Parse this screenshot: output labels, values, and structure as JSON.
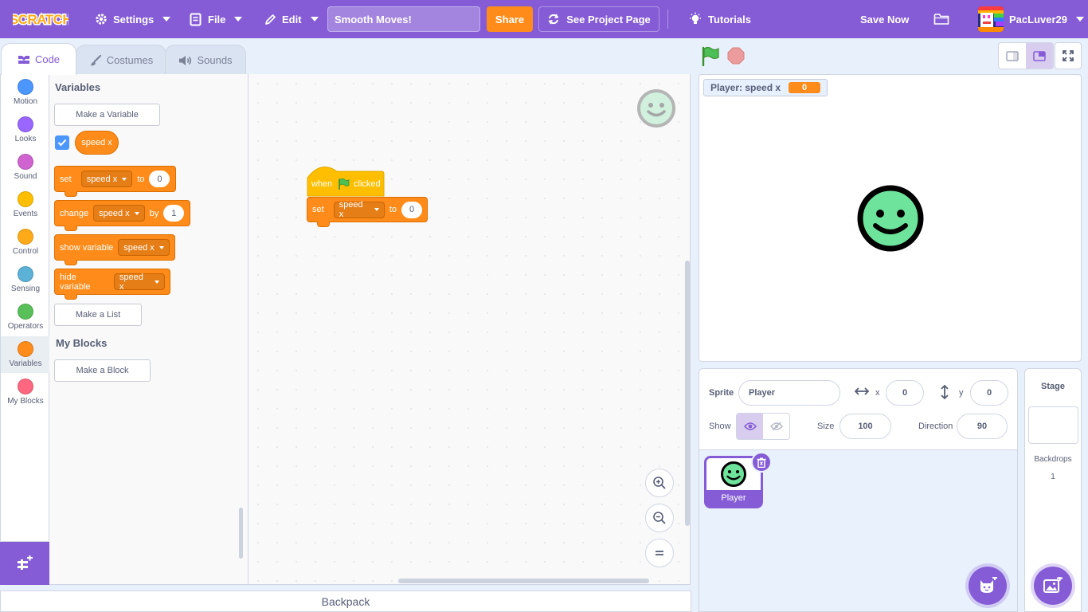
{
  "menubar": {
    "logo_text": "SCRATCH",
    "settings": "Settings",
    "file": "File",
    "edit": "Edit",
    "project_title": "Smooth Moves!",
    "share": "Share",
    "see_project_page": "See Project Page",
    "tutorials": "Tutorials",
    "save_now": "Save Now",
    "username": "PacLuver29",
    "bg_color": "#855cd6"
  },
  "tabs": [
    {
      "label": "Code",
      "active": true
    },
    {
      "label": "Costumes",
      "active": false
    },
    {
      "label": "Sounds",
      "active": false
    }
  ],
  "categories": [
    {
      "label": "Motion",
      "color": "#4c97ff"
    },
    {
      "label": "Looks",
      "color": "#9966ff"
    },
    {
      "label": "Sound",
      "color": "#cf63cf"
    },
    {
      "label": "Events",
      "color": "#ffbf00"
    },
    {
      "label": "Control",
      "color": "#ffab19"
    },
    {
      "label": "Sensing",
      "color": "#5cb1d6"
    },
    {
      "label": "Operators",
      "color": "#59c059"
    },
    {
      "label": "Variables",
      "color": "#ff8c1a"
    },
    {
      "label": "My Blocks",
      "color": "#ff6680"
    }
  ],
  "palette": {
    "variables_heading": "Variables",
    "make_variable": "Make a Variable",
    "variable_name": "speed x",
    "variable_checked": true,
    "set_block": {
      "word": "set",
      "var": "speed x",
      "to": "to",
      "value": "0"
    },
    "change_block": {
      "word": "change",
      "var": "speed x",
      "by": "by",
      "value": "1"
    },
    "show_block": {
      "word": "show variable",
      "var": "speed x"
    },
    "hide_block": {
      "word": "hide variable",
      "var": "speed x"
    },
    "make_list": "Make a List",
    "myblocks_heading": "My Blocks",
    "make_block": "Make a Block"
  },
  "script": {
    "hat_when": "when",
    "hat_clicked": "clicked",
    "set_word": "set",
    "set_var": "speed x",
    "set_to": "to",
    "set_value": "0"
  },
  "backpack": "Backpack",
  "stage": {
    "monitor_label": "Player: speed x",
    "monitor_value": "0"
  },
  "sprite_info": {
    "sprite_label": "Sprite",
    "sprite_name": "Player",
    "x_label": "x",
    "x_value": "0",
    "y_label": "y",
    "y_value": "0",
    "show_label": "Show",
    "size_label": "Size",
    "size_value": "100",
    "direction_label": "Direction",
    "direction_value": "90"
  },
  "sprites": [
    {
      "name": "Player",
      "selected": true
    }
  ],
  "stage_pane": {
    "heading": "Stage",
    "backdrops_label": "Backdrops",
    "backdrops_count": "1"
  },
  "icons": {
    "settings": "gear-icon",
    "file": "file-icon",
    "edit": "pencil-icon",
    "see_project": "swap-arrows-icon",
    "tutorials": "lightbulb-icon",
    "my_stuff": "folder-icon",
    "green_flag": "green-flag-icon",
    "stop": "stop-icon",
    "add_extension": "add-extension-icon",
    "choose_sprite": "cat-plus-icon",
    "choose_backdrop": "image-plus-icon"
  }
}
